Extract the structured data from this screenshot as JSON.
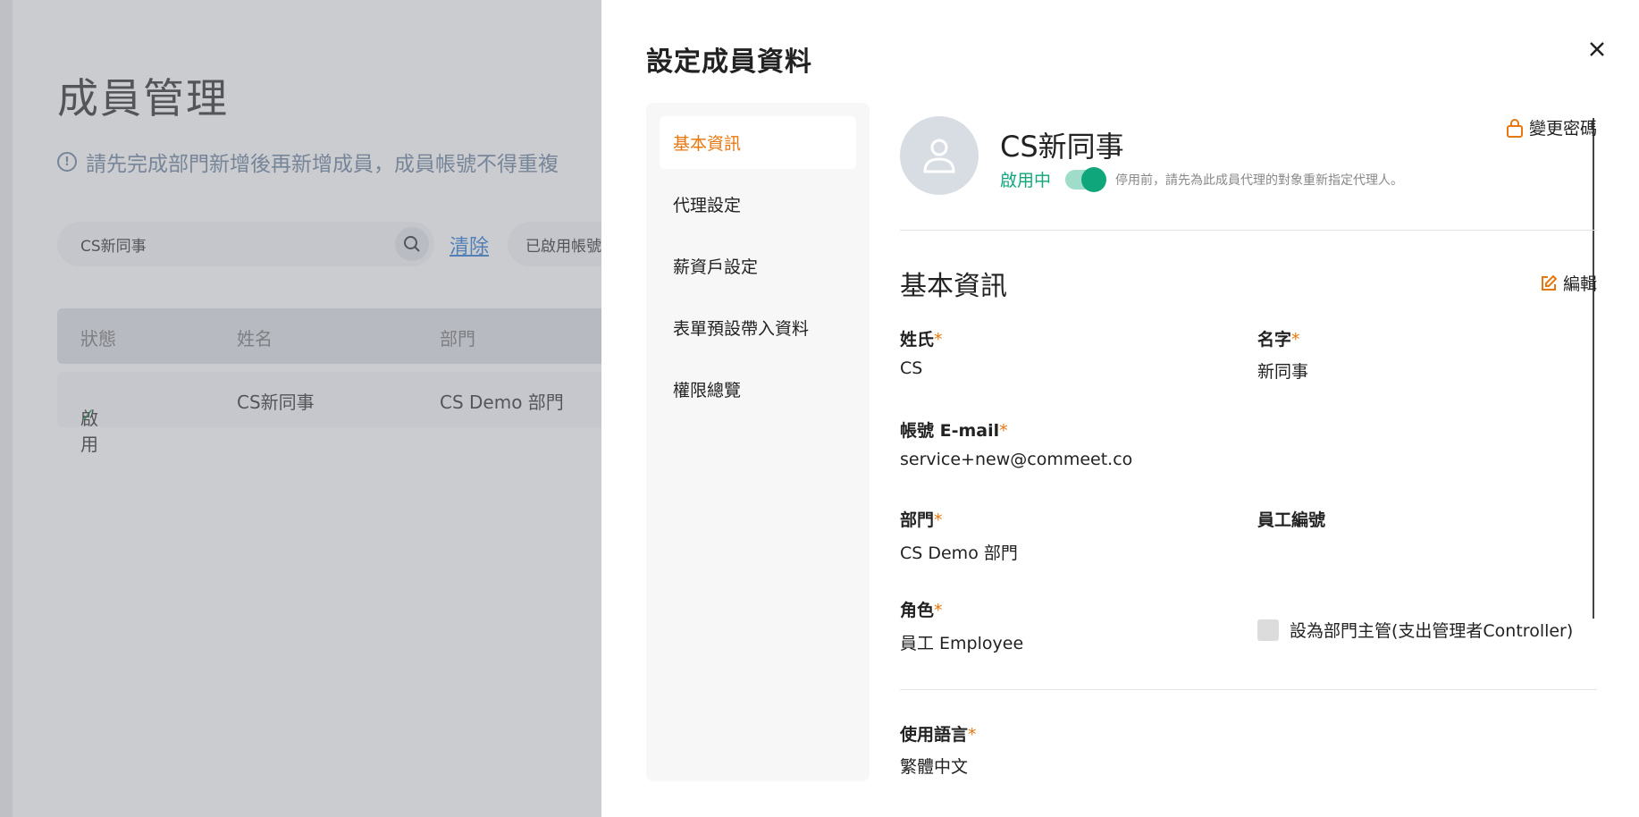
{
  "background": {
    "page_title": "成員管理",
    "notice": "請先完成部門新增後再新增成員，成員帳號不得重複",
    "search_value": "CS新同事",
    "clear_label": "清除",
    "filter_label": "已啟用帳號",
    "table": {
      "columns": [
        "狀態",
        "姓名",
        "部門"
      ],
      "rows": [
        {
          "status": "啟用",
          "name": "CS新同事",
          "department": "CS Demo 部門"
        }
      ]
    }
  },
  "drawer": {
    "title": "設定成員資料",
    "nav": [
      {
        "label": "基本資訊",
        "active": true
      },
      {
        "label": "代理設定",
        "active": false
      },
      {
        "label": "薪資戶設定",
        "active": false
      },
      {
        "label": "表單預設帶入資料",
        "active": false
      },
      {
        "label": "權限總覽",
        "active": false
      }
    ],
    "profile": {
      "name": "CS新同事",
      "status": "啟用中",
      "status_hint": "停用前，請先為此成員代理的對象重新指定代理人。",
      "change_password": "變更密碼"
    },
    "section": {
      "title": "基本資訊",
      "edit_label": "編輯"
    },
    "fields": {
      "last_name_label": "姓氏",
      "last_name_value": "CS",
      "first_name_label": "名字",
      "first_name_value": "新同事",
      "email_label": "帳號 E-mail",
      "email_value": "service+new@commeet.co",
      "department_label": "部門",
      "department_value": "CS Demo 部門",
      "employee_id_label": "員工編號",
      "role_label": "角色",
      "role_value": "員工 Employee",
      "manager_checkbox_label": "設為部門主管(支出管理者Controller)",
      "language_label": "使用語言",
      "language_value": "繁體中文"
    }
  },
  "colors": {
    "accent": "#e8770f",
    "active_green": "#10a67c",
    "link_blue": "#2f7bd2"
  }
}
